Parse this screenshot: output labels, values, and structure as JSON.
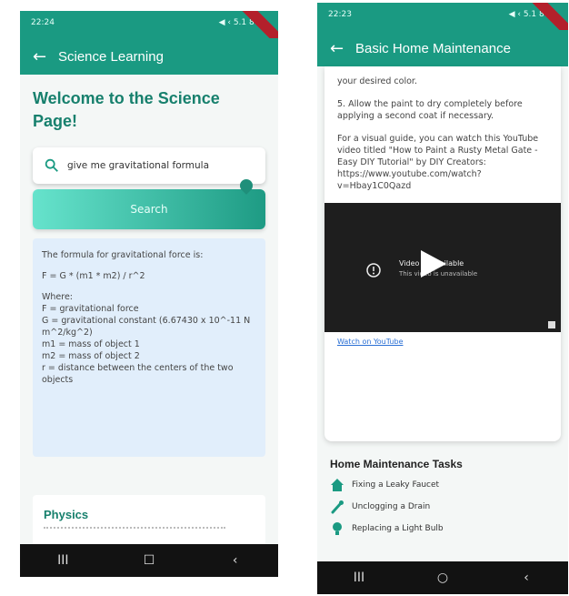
{
  "left": {
    "status": {
      "time": "22:24",
      "right": "◀ ‹ 5.1 80%"
    },
    "appbar": {
      "back": "←",
      "title": "Science Learning"
    },
    "welcome": "Welcome to the Science Page!",
    "search": {
      "value": "give me gravitational formula",
      "button": "Search"
    },
    "answer": {
      "intro": "The formula for gravitational force is:",
      "formula": "F = G * (m1 * m2) / r^2",
      "where": "Where:",
      "lines": [
        "F = gravitational force",
        "G = gravitational constant (6.67430 x 10^-11 N m^2/kg^2)",
        "m1 = mass of object 1",
        "m2 = mass of object 2",
        "r = distance between the centers of the two objects"
      ]
    },
    "physics": "Physics",
    "nav": {
      "recent": "III",
      "home": "☐",
      "back": "‹"
    }
  },
  "right": {
    "status": {
      "time": "22:23",
      "right": "◀ ‹ 5.1 80%"
    },
    "appbar": {
      "back": "←",
      "title": "Basic Home Maintenance"
    },
    "article": {
      "p1": "your desired color.",
      "p2": "5. Allow the paint to dry completely before applying a second coat if necessary.",
      "p3": "For a visual guide, you can watch this YouTube video titled \"How to Paint a Rusty Metal Gate - Easy DIY Tutorial\" by DIY Creators: https://www.youtube.com/watch?v=Hbay1C0Qazd"
    },
    "video": {
      "title": "Video unavailable",
      "subtitle": "This video is unavailable"
    },
    "yt_link": "Watch on YouTube",
    "tasks_title": "Home Maintenance Tasks",
    "tasks": [
      {
        "label": "Fixing a Leaky Faucet",
        "icon": "home-icon"
      },
      {
        "label": "Unclogging a Drain",
        "icon": "wrench-icon"
      },
      {
        "label": "Replacing a Light Bulb",
        "icon": "lightbulb-icon"
      }
    ],
    "nav": {
      "recent": "III",
      "home": "○",
      "back": "‹"
    }
  },
  "colors": {
    "primary": "#1a9a82",
    "accent_text": "#17806d",
    "answer_bg": "#e1eefb",
    "nav_bg": "#121212"
  }
}
